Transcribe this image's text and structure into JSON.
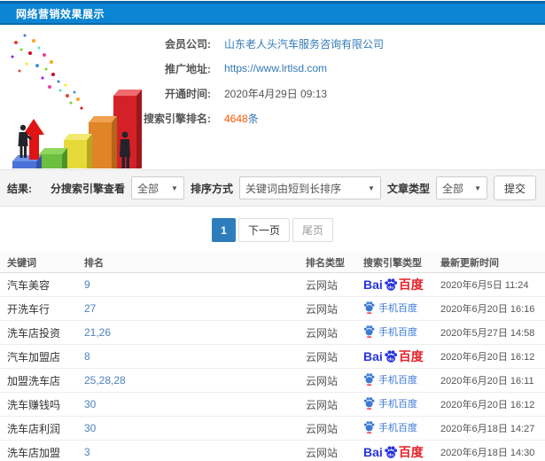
{
  "header": {
    "title": "网络营销效果展示"
  },
  "info": {
    "member_label": "会员公司:",
    "member_value": "山东老人头汽车服务咨询有限公司",
    "url_label": "推广地址:",
    "url_value": "https://www.lrtlsd.com",
    "open_label": "开通时间:",
    "open_value": "2020年4月29日 09:13",
    "rank_label": "搜索引擎排名:",
    "rank_count": "4648",
    "rank_unit": "条"
  },
  "filters": {
    "results_label": "结果:",
    "engine_label": "分搜索引擎查看",
    "engine_value": "全部",
    "sort_label": "排序方式",
    "sort_value": "关键词由短到长排序",
    "type_label": "文章类型",
    "type_value": "全部",
    "submit_label": "提交"
  },
  "icons": {
    "dropdown_caret": "▼"
  },
  "pagination": {
    "current": "1",
    "next": "下一页",
    "last": "尾页"
  },
  "table": {
    "headers": [
      "关键词",
      "排名",
      "排名类型",
      "搜索引擎类型",
      "最新更新时间"
    ],
    "baidu_wordmark": {
      "bai": "Bai",
      "du": "du",
      "chinese": "百度"
    },
    "mobile_engine_name": "手机百度",
    "rows": [
      {
        "keyword": "汽车美容",
        "rank": "9",
        "rank_type": "云网站",
        "engine": "pc",
        "updated": "2020年6月5日 11:24"
      },
      {
        "keyword": "开洗车行",
        "rank": "27",
        "rank_type": "云网站",
        "engine": "mobile",
        "updated": "2020年6月20日 16:16"
      },
      {
        "keyword": "洗车店投资",
        "rank": "21,26",
        "rank_type": "云网站",
        "engine": "mobile",
        "updated": "2020年5月27日 14:58"
      },
      {
        "keyword": "汽车加盟店",
        "rank": "8",
        "rank_type": "云网站",
        "engine": "pc",
        "updated": "2020年6月20日 16:12"
      },
      {
        "keyword": "加盟洗车店",
        "rank": "25,28,28",
        "rank_type": "云网站",
        "engine": "mobile",
        "updated": "2020年6月20日 16:11"
      },
      {
        "keyword": "洗车赚钱吗",
        "rank": "30",
        "rank_type": "云网站",
        "engine": "mobile",
        "updated": "2020年6月20日 16:12"
      },
      {
        "keyword": "洗车店利润",
        "rank": "30",
        "rank_type": "云网站",
        "engine": "mobile",
        "updated": "2020年6月18日 14:27"
      },
      {
        "keyword": "洗车店加盟",
        "rank": "3",
        "rank_type": "云网站",
        "engine": "pc",
        "updated": "2020年6月18日 14:30"
      }
    ]
  },
  "colors": {
    "header_blue": "#0b84d3",
    "header_blue_dark": "#0667a9",
    "link_blue": "#337ab7",
    "count_orange": "#ff5500",
    "rank_blue": "#4d7fbf",
    "baidu_blue": "#2733dd",
    "baidu_red": "#e62129",
    "mobile_baidu_blue": "#3b7bd6",
    "pagination_active": "#2d7dbd",
    "filter_bar_bg": "#f4f4f4"
  }
}
